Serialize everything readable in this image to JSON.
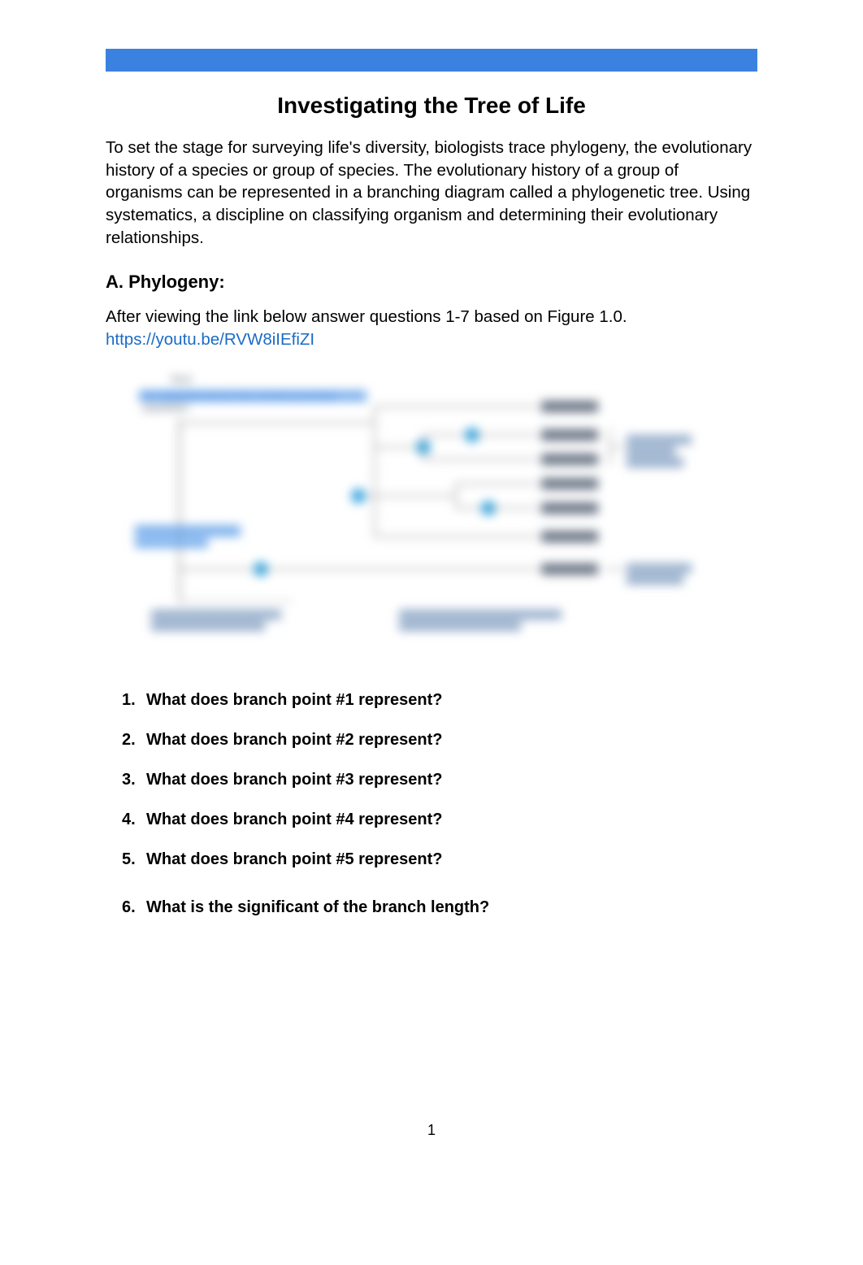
{
  "header": {
    "title": "Investigating the Tree of Life"
  },
  "intro": {
    "text": "To set the stage for surveying life's diversity, biologists trace phylogeny, the evolutionary history of a species or group of species. The evolutionary history of a group of organisms can be represented in a branching diagram called a phylogenetic tree. Using systematics, a discipline on classifying organism and determining their evolutionary relationships."
  },
  "section_a": {
    "heading": "A. Phylogeny:",
    "instruction": "After viewing the link below answer questions 1-7 based on Figure 1.0.",
    "link": "https://youtu.be/RVW8iIEfiZI"
  },
  "diagram": {
    "taxa": [
      "Taxon A",
      "Taxon B",
      "Taxon C",
      "Taxon D",
      "Taxon E",
      "Taxon F",
      "Taxon G"
    ],
    "root_label": "Root",
    "top_left_label": "An unlabeled branch from common ancestral population",
    "mid_left_label": "Ancestral lineage (clade base)",
    "bottom_left_label": "An inferred (branch from ancestral) population",
    "bottom_right_label": "An inferred (clade) from common ancestral population",
    "right_label_1": "Monophyletic group (shared derived trait)",
    "right_label_2": "Basal taxon (an outgroup)"
  },
  "questions": [
    {
      "num": "1.",
      "text": "What does branch point #1 represent?"
    },
    {
      "num": "2.",
      "text": "What does branch point #2 represent?"
    },
    {
      "num": "3.",
      "text": "What does branch point #3 represent?"
    },
    {
      "num": "4.",
      "text": "What does branch point #4 represent?"
    },
    {
      "num": "5.",
      "text": "What does branch point #5 represent?"
    },
    {
      "num": "6.",
      "text": "What is the significant of the branch length?"
    }
  ],
  "page_number": "1"
}
